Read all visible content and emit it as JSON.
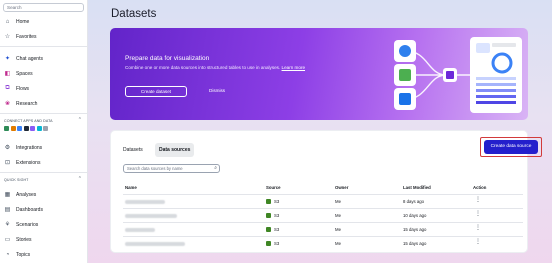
{
  "sidebar": {
    "search_placeholder": "Search",
    "items_top": [
      {
        "label": "Home",
        "icon": "home-icon"
      },
      {
        "label": "Favorites",
        "icon": "star-icon"
      }
    ],
    "items_mid": [
      {
        "label": "Chat agents",
        "icon": "chat-icon"
      },
      {
        "label": "Spaces",
        "icon": "spaces-icon"
      },
      {
        "label": "Flows",
        "icon": "flows-icon"
      },
      {
        "label": "Research",
        "icon": "research-icon"
      }
    ],
    "connect_section": "CONNECT APPS AND DATA",
    "connect_items": [
      {
        "label": "Integrations",
        "icon": "integrations-icon"
      },
      {
        "label": "Extensions",
        "icon": "extensions-icon"
      }
    ],
    "quicksight_section": "QUICK SIGHT",
    "quicksight_items": [
      {
        "label": "Analyses",
        "icon": "analyses-icon"
      },
      {
        "label": "Dashboards",
        "icon": "dashboards-icon"
      },
      {
        "label": "Scenarios",
        "icon": "scenarios-icon"
      },
      {
        "label": "Stories",
        "icon": "stories-icon"
      },
      {
        "label": "Topics",
        "icon": "topics-icon"
      }
    ],
    "app_icon_colors": [
      "#2e8b57",
      "#e07b00",
      "#3b82f6",
      "#1f2937",
      "#8b5cf6",
      "#06b6d4",
      "#9ca3af"
    ]
  },
  "page": {
    "title": "Datasets"
  },
  "banner": {
    "title": "Prepare data for visualization",
    "description": "Combine one or more data sources into structured tables to use in analyses.",
    "learn_more": "Learn more",
    "create_button": "Create dataset",
    "dismiss": "Dismiss"
  },
  "panel": {
    "tabs": [
      {
        "label": "Datasets",
        "active": false
      },
      {
        "label": "Data sources",
        "active": true
      }
    ],
    "create_source_button": "Create data source",
    "search_placeholder": "Search data sources by name",
    "columns": [
      "Name",
      "Source",
      "Owner",
      "Last Modified",
      "Action"
    ],
    "rows": [
      {
        "source": "S3",
        "owner": "Me",
        "modified": "8 days ago"
      },
      {
        "source": "S3",
        "owner": "Me",
        "modified": "10 days ago"
      },
      {
        "source": "S3",
        "owner": "Me",
        "modified": "15 days ago"
      },
      {
        "source": "S3",
        "owner": "Me",
        "modified": "15 days ago"
      }
    ]
  },
  "colors": {
    "accent": "#231fcc",
    "highlight": "#d23b3b",
    "s3": "#3f8624"
  }
}
